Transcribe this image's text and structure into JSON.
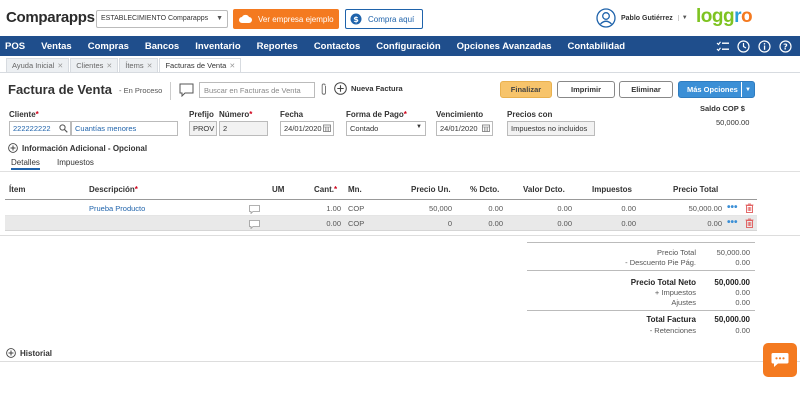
{
  "header": {
    "app_name": "Comparapps",
    "establishment": "ESTABLECIMIENTO Comparapps",
    "example_button": "Ver empresa ejemplo",
    "buy_button": "Compra aquí",
    "user_name": "Pablo Gutiérrez",
    "brand_logo": "loggro",
    "colors": {
      "orange": "#f47a20",
      "navy": "#1f4e8c",
      "blue_link": "#1f63ab",
      "green": "#7ec321"
    }
  },
  "nav": {
    "items": [
      "POS",
      "Ventas",
      "Compras",
      "Bancos",
      "Inventario",
      "Reportes",
      "Contactos",
      "Configuración",
      "Opciones Avanzadas",
      "Contabilidad"
    ],
    "icons": [
      "list-check-icon",
      "clock-icon",
      "info-icon",
      "help-icon"
    ]
  },
  "tabs": [
    {
      "label": "Ayuda Inicial"
    },
    {
      "label": "Clientes"
    },
    {
      "label": "Ítems"
    },
    {
      "label": "Facturas de Venta",
      "active": true
    }
  ],
  "page": {
    "title": "Factura de Venta",
    "status": "- En Proceso",
    "search_placeholder": "Buscar en Facturas de Venta",
    "new_invoice": "Nueva Factura",
    "buttons": {
      "finalize": "Finalizar",
      "print": "Imprimir",
      "delete": "Eliminar",
      "more": "Más Opciones"
    },
    "balance_label": "Saldo COP $",
    "balance_value": "50,000.00"
  },
  "form": {
    "cliente_label": "Cliente",
    "cliente_id": "222222222",
    "cliente_name": "Cuantías menores",
    "prefijo_label": "Prefijo",
    "prefijo_value": "PROV",
    "numero_label": "Número",
    "numero_value": "2",
    "fecha_label": "Fecha",
    "fecha_value": "24/01/2020",
    "forma_pago_label": "Forma de Pago",
    "forma_pago_value": "Contado",
    "vencimiento_label": "Vencimiento",
    "vencimiento_value": "24/01/2020",
    "precios_label": "Precios con",
    "precios_value": "Impuestos no incluidos",
    "info_adicional": "Información Adicional - Opcional"
  },
  "subtabs": [
    "Detalles",
    "Impuestos"
  ],
  "table": {
    "headers": {
      "item": "Ítem",
      "descripcion": "Descripción",
      "um": "UM",
      "cant": "Cant.",
      "mn": "Mn.",
      "precio_un": "Precio Un.",
      "pct_dcto": "% Dcto.",
      "valor_dcto": "Valor Dcto.",
      "impuestos": "Impuestos",
      "precio_total": "Precio Total"
    },
    "rows": [
      {
        "item": "",
        "descripcion": "Prueba Producto",
        "cant": "1.00",
        "mn": "COP",
        "precio_un": "50,000",
        "pct_dcto": "0.00",
        "valor_dcto": "0.00",
        "impuestos": "0.00",
        "precio_total": "50,000.00"
      },
      {
        "item": "",
        "descripcion": "",
        "cant": "0.00",
        "mn": "COP",
        "precio_un": "0",
        "pct_dcto": "0.00",
        "valor_dcto": "0.00",
        "impuestos": "0.00",
        "precio_total": "0.00"
      }
    ]
  },
  "totals": {
    "precio_total_label": "Precio Total",
    "precio_total": "50,000.00",
    "descuento_label": "- Descuento Pie Pág.",
    "descuento": "0.00",
    "neto_label": "Precio Total Neto",
    "neto": "50,000.00",
    "impuestos_label": "+ Impuestos",
    "impuestos": "0.00",
    "ajustes_label": "Ajustes",
    "ajustes": "0.00",
    "total_factura_label": "Total Factura",
    "total_factura": "50,000.00",
    "retenciones_label": "- Retenciones",
    "retenciones": "0.00"
  },
  "historial": "Historial"
}
